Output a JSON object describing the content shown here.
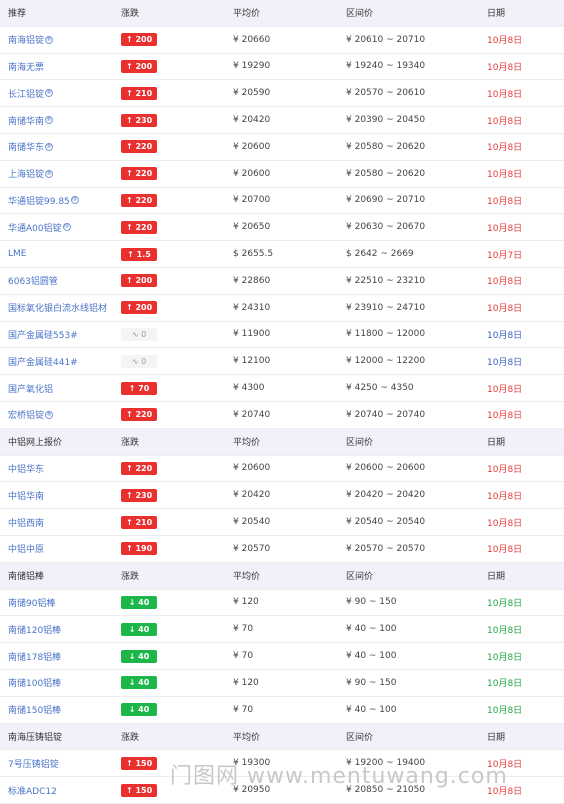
{
  "sections": [
    {
      "header": [
        "推荐",
        "涨跌",
        "平均价",
        "区间价",
        "日期"
      ],
      "rows": [
        {
          "name": "南海铝锭",
          "sup": "®",
          "change": "↑ 200",
          "dir": "up",
          "avg": "¥ 20660",
          "range": "¥ 20610 ~ 20710",
          "date": "10月8日",
          "dc": "red"
        },
        {
          "name": "南海无票",
          "sup": "",
          "change": "↑ 200",
          "dir": "up",
          "avg": "¥ 19290",
          "range": "¥ 19240 ~ 19340",
          "date": "10月8日",
          "dc": "red"
        },
        {
          "name": "长江铝锭",
          "sup": "®",
          "change": "↑ 210",
          "dir": "up",
          "avg": "¥ 20590",
          "range": "¥ 20570 ~ 20610",
          "date": "10月8日",
          "dc": "red"
        },
        {
          "name": "南储华南",
          "sup": "®",
          "change": "↑ 230",
          "dir": "up",
          "avg": "¥ 20420",
          "range": "¥ 20390 ~ 20450",
          "date": "10月8日",
          "dc": "red"
        },
        {
          "name": "南储华东",
          "sup": "®",
          "change": "↑ 220",
          "dir": "up",
          "avg": "¥ 20600",
          "range": "¥ 20580 ~ 20620",
          "date": "10月8日",
          "dc": "red"
        },
        {
          "name": "上海铝锭",
          "sup": "®",
          "change": "↑ 220",
          "dir": "up",
          "avg": "¥ 20600",
          "range": "¥ 20580 ~ 20620",
          "date": "10月8日",
          "dc": "red"
        },
        {
          "name": "华通铝锭99.85",
          "sup": "®",
          "change": "↑ 220",
          "dir": "up",
          "avg": "¥ 20700",
          "range": "¥ 20690 ~ 20710",
          "date": "10月8日",
          "dc": "red"
        },
        {
          "name": "华通A00铝锭",
          "sup": "®",
          "change": "↑ 220",
          "dir": "up",
          "avg": "¥ 20650",
          "range": "¥ 20630 ~ 20670",
          "date": "10月8日",
          "dc": "red"
        },
        {
          "name": "LME",
          "sup": "",
          "change": "↑ 1.5",
          "dir": "up",
          "avg": "$ 2655.5",
          "range": "$ 2642 ~ 2669",
          "date": "10月7日",
          "dc": "red"
        },
        {
          "name": "6063铝圆管",
          "sup": "",
          "change": "↑ 200",
          "dir": "up",
          "avg": "¥ 22860",
          "range": "¥ 22510 ~ 23210",
          "date": "10月8日",
          "dc": "red"
        },
        {
          "name": "国标氧化银白流水线铝材",
          "sup": "",
          "change": "↑ 200",
          "dir": "up",
          "avg": "¥ 24310",
          "range": "¥ 23910 ~ 24710",
          "date": "10月8日",
          "dc": "red"
        },
        {
          "name": "国产金属硅553#",
          "sup": "",
          "change": "∿ 0",
          "dir": "flat",
          "avg": "¥ 11900",
          "range": "¥ 11800 ~ 12000",
          "date": "10月8日",
          "dc": "blue"
        },
        {
          "name": "国产金属硅441#",
          "sup": "",
          "change": "∿ 0",
          "dir": "flat",
          "avg": "¥ 12100",
          "range": "¥ 12000 ~ 12200",
          "date": "10月8日",
          "dc": "blue"
        },
        {
          "name": "国产氧化铝",
          "sup": "",
          "change": "↑ 70",
          "dir": "up",
          "avg": "¥ 4300",
          "range": "¥ 4250 ~ 4350",
          "date": "10月8日",
          "dc": "red"
        },
        {
          "name": "宏桥铝锭",
          "sup": "®",
          "change": "↑ 220",
          "dir": "up",
          "avg": "¥ 20740",
          "range": "¥ 20740 ~ 20740",
          "date": "10月8日",
          "dc": "red"
        }
      ]
    },
    {
      "header": [
        "中铝网上报价",
        "涨跌",
        "平均价",
        "区间价",
        "日期"
      ],
      "rows": [
        {
          "name": "中铝华东",
          "sup": "",
          "change": "↑ 220",
          "dir": "up",
          "avg": "¥ 20600",
          "range": "¥ 20600 ~ 20600",
          "date": "10月8日",
          "dc": "red"
        },
        {
          "name": "中铝华南",
          "sup": "",
          "change": "↑ 230",
          "dir": "up",
          "avg": "¥ 20420",
          "range": "¥ 20420 ~ 20420",
          "date": "10月8日",
          "dc": "red"
        },
        {
          "name": "中铝西南",
          "sup": "",
          "change": "↑ 210",
          "dir": "up",
          "avg": "¥ 20540",
          "range": "¥ 20540 ~ 20540",
          "date": "10月8日",
          "dc": "red"
        },
        {
          "name": "中铝中原",
          "sup": "",
          "change": "↑ 190",
          "dir": "up",
          "avg": "¥ 20570",
          "range": "¥ 20570 ~ 20570",
          "date": "10月8日",
          "dc": "red"
        }
      ]
    },
    {
      "header": [
        "南储铝棒",
        "涨跌",
        "平均价",
        "区间价",
        "日期"
      ],
      "rows": [
        {
          "name": "南储90铝棒",
          "sup": "",
          "change": "↓ 40",
          "dir": "down",
          "avg": "¥ 120",
          "range": "¥ 90 ~ 150",
          "date": "10月8日",
          "dc": "green"
        },
        {
          "name": "南储120铝棒",
          "sup": "",
          "change": "↓ 40",
          "dir": "down",
          "avg": "¥ 70",
          "range": "¥ 40 ~ 100",
          "date": "10月8日",
          "dc": "green"
        },
        {
          "name": "南储178铝棒",
          "sup": "",
          "change": "↓ 40",
          "dir": "down",
          "avg": "¥ 70",
          "range": "¥ 40 ~ 100",
          "date": "10月8日",
          "dc": "green"
        },
        {
          "name": "南储100铝棒",
          "sup": "",
          "change": "↓ 40",
          "dir": "down",
          "avg": "¥ 120",
          "range": "¥ 90 ~ 150",
          "date": "10月8日",
          "dc": "green"
        },
        {
          "name": "南储150铝棒",
          "sup": "",
          "change": "↓ 40",
          "dir": "down",
          "avg": "¥ 70",
          "range": "¥ 40 ~ 100",
          "date": "10月8日",
          "dc": "green"
        }
      ]
    },
    {
      "header": [
        "南海压铸铝锭",
        "涨跌",
        "平均价",
        "区间价",
        "日期"
      ],
      "rows": [
        {
          "name": "7号压铸铝锭",
          "sup": "",
          "change": "↑ 150",
          "dir": "up",
          "avg": "¥ 19300",
          "range": "¥ 19200 ~ 19400",
          "date": "10月8日",
          "dc": "red"
        },
        {
          "name": "标准ADC12",
          "sup": "",
          "change": "↑ 150",
          "dir": "up",
          "avg": "¥ 20950",
          "range": "¥ 20850 ~ 21050",
          "date": "10月8日",
          "dc": "red"
        }
      ]
    }
  ],
  "watermark": "门图网 www.mentuwang.com"
}
